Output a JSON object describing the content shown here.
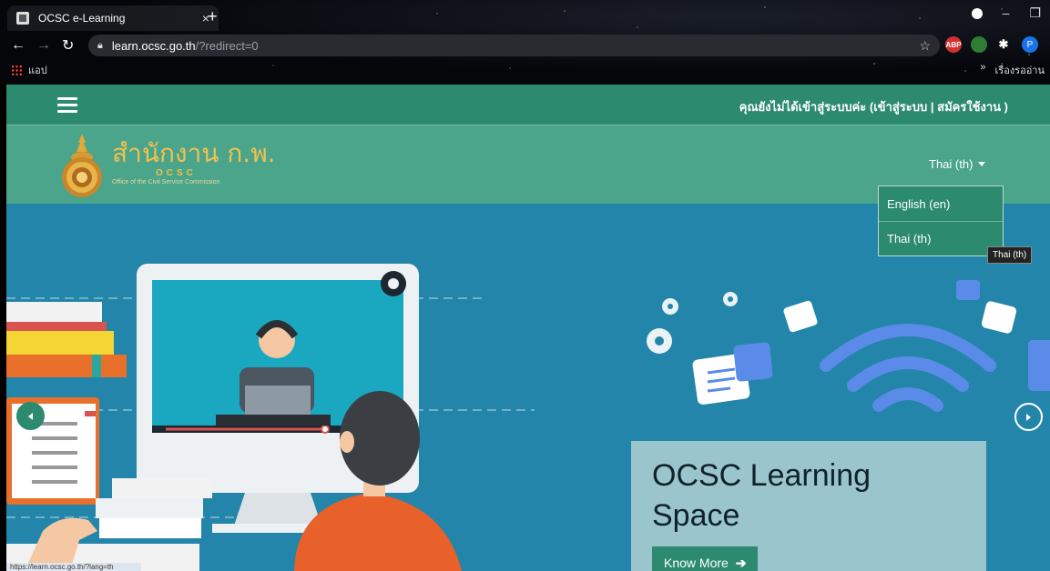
{
  "browser": {
    "tab_title": "OCSC e-Learning",
    "tab_close": "×",
    "new_tab": "+",
    "url_host": "learn.ocsc.go.th",
    "url_path": "/?redirect=0",
    "bookmark_apps": "แอป",
    "bookmark_more": "»",
    "bookmark_reading_list": "เรื่องรออ่าน",
    "profile_initial": "P",
    "ext_abp": "ABP",
    "status_text": "https://learn.ocsc.go.th/?lang=th"
  },
  "header": {
    "login_prefix": "คุณยังไม่ได้เข้าสู่ระบบค่ะ (",
    "login_link": "เข้าสู่ระบบ",
    "separator": " | ",
    "register_link": "สมัครใช้งาน",
    "login_suffix": " )"
  },
  "brand": {
    "name_th": "สำนักงาน ก.พ.",
    "acronym": "OCSC",
    "subtitle": "Office of the Civil Service Commission"
  },
  "language": {
    "current": "Thai (th)",
    "options": [
      "English (en)",
      "Thai (th)"
    ],
    "tooltip": "Thai (th)"
  },
  "hero": {
    "title": "OCSC Learning Space",
    "button_label": "Know More"
  },
  "colors": {
    "topbar": "#2c8a6f",
    "brandbar": "#4aa58a",
    "hero_bg": "#2385a9",
    "accent": "#2c8a6f",
    "logo_gold": "#f2c14e"
  }
}
